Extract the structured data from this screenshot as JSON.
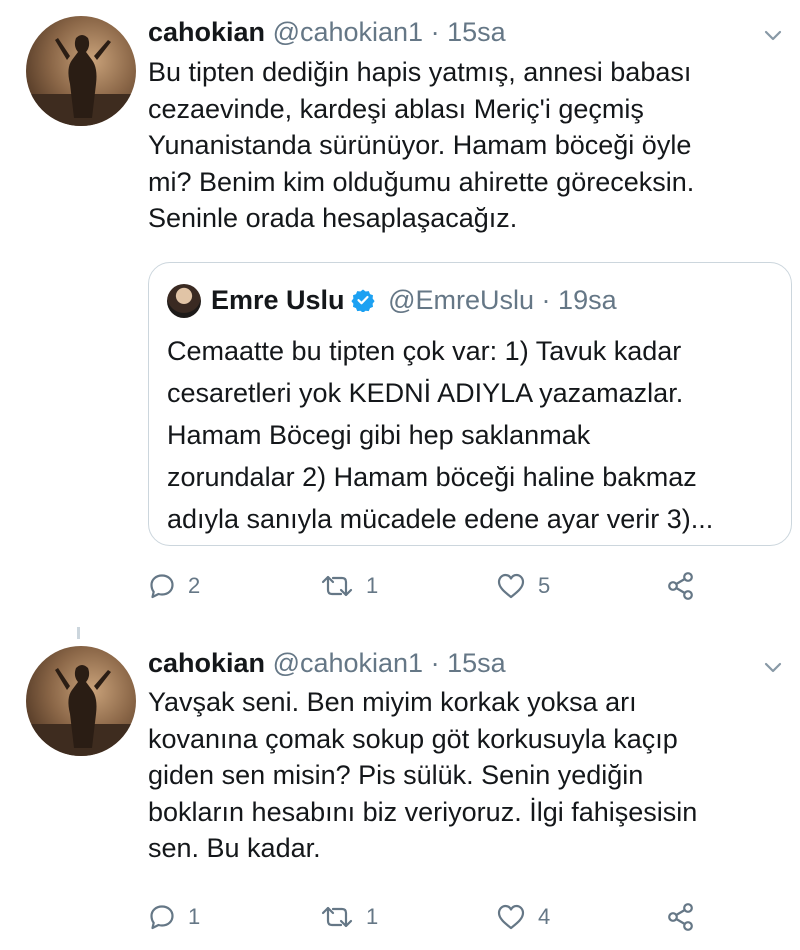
{
  "tweets": [
    {
      "name": "cahokian",
      "handle": "@cahokian1",
      "dot": "·",
      "time": "15sa",
      "lines": [
        "Bu tipten dediğin hapis yatmış, annesi babası",
        "cezaevinde, kardeşi ablası Meriç'i geçmiş",
        "Yunanistanda sürünüyor. Hamam böceği öyle",
        "mi? Benim kim olduğumu ahirette göreceksin.",
        "Seninle orada hesaplaşacağız."
      ],
      "quote": {
        "name": "Emre Uslu",
        "handle": "@EmreUslu",
        "dot": "·",
        "time": "19sa",
        "lines": [
          "Cemaatte bu tipten çok var: 1) Tavuk kadar",
          "cesaretleri yok KEDNİ ADIYLA yazamazlar.",
          "Hamam Böcegi gibi hep saklanmak",
          "zorundalar 2) Hamam böceği haline bakmaz",
          "adıyla sanıyla mücadele edene ayar verir 3)..."
        ]
      },
      "replies": "2",
      "retweets": "1",
      "likes": "5"
    },
    {
      "name": "cahokian",
      "handle": "@cahokian1",
      "dot": "·",
      "time": "15sa",
      "lines": [
        "Yavşak seni. Ben miyim korkak yoksa arı",
        "kovanına çomak sokup göt korkusuyla kaçıp",
        "giden sen misin? Pis sülük. Senin yediğin",
        "bokların hesabını biz veriyoruz. İlgi fahişesisin",
        "sen. Bu kadar."
      ],
      "replies": "1",
      "retweets": "1",
      "likes": "4"
    }
  ],
  "colors": {
    "text": "#14171a",
    "muted": "#657786",
    "border": "#ccd6dd",
    "verified": "#1da1f2"
  },
  "icons": [
    "chevron-down-icon",
    "reply-icon",
    "retweet-icon",
    "like-icon",
    "share-icon",
    "verified-icon"
  ]
}
